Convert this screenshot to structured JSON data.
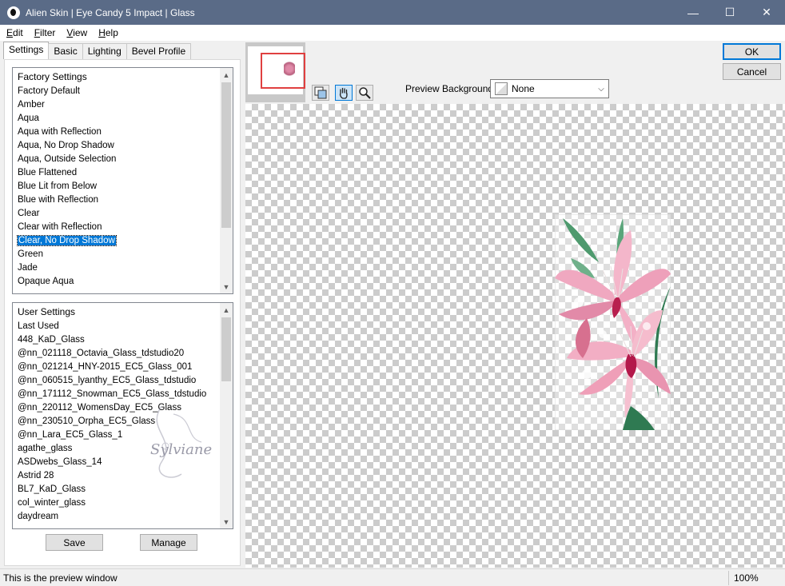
{
  "window": {
    "title": "Alien Skin | Eye Candy 5 Impact | Glass",
    "minimize_glyph": "—",
    "maximize_glyph": "☐",
    "close_glyph": "✕"
  },
  "menu": [
    {
      "label": "Edit",
      "accel": "E",
      "rest": "dit"
    },
    {
      "label": "Filter",
      "accel": "F",
      "rest": "ilter"
    },
    {
      "label": "View",
      "accel": "V",
      "rest": "iew"
    },
    {
      "label": "Help",
      "accel": "H",
      "rest": "elp"
    }
  ],
  "tabs": [
    "Settings",
    "Basic",
    "Lighting",
    "Bevel Profile"
  ],
  "factory": {
    "header": "Factory Settings",
    "items": [
      "Factory Default",
      "Amber",
      "Aqua",
      "Aqua with Reflection",
      "Aqua, No Drop Shadow",
      "Aqua, Outside Selection",
      "Blue Flattened",
      "Blue Lit from Below",
      "Blue with Reflection",
      "Clear",
      "Clear with Reflection",
      "Clear, No Drop Shadow",
      "Green",
      "Jade",
      "Opaque Aqua"
    ],
    "selected_index": 11
  },
  "user": {
    "header": "User Settings",
    "items": [
      "Last Used",
      "448_KaD_Glass",
      "@nn_021118_Octavia_Glass_tdstudio20",
      "@nn_021214_HNY-2015_EC5_Glass_001",
      "@nn_060515_lyanthy_EC5_Glass_tdstudio",
      "@nn_171112_Snowman_EC5_Glass_tdstudio",
      "@nn_220112_WomensDay_EC5_Glass",
      "@nn_230510_Orpha_EC5_Glass",
      "@nn_Lara_EC5_Glass_1",
      "agathe_glass",
      "ASDwebs_Glass_14",
      "Astrid 28",
      "BL7_KaD_Glass",
      "col_winter_glass",
      "daydream"
    ]
  },
  "buttons": {
    "save": "Save",
    "manage": "Manage",
    "ok": "OK",
    "cancel": "Cancel"
  },
  "tools": {
    "navigate_icon": "navigate-icon",
    "hand_icon": "hand-icon",
    "zoom_icon": "zoom-icon"
  },
  "preview_background": {
    "label": "Preview Background:",
    "value": "None"
  },
  "watermark": "Sylviane",
  "status": {
    "message": "This is the preview window",
    "zoom": "100%"
  }
}
